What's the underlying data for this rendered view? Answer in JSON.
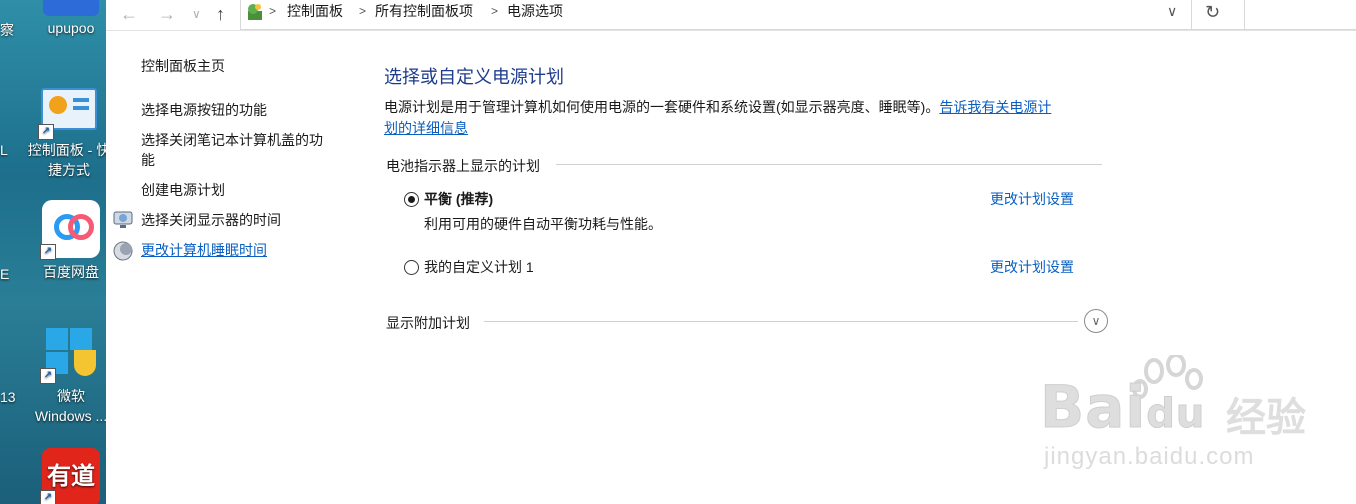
{
  "desktop": {
    "icons": [
      {
        "label": "upupoo"
      },
      {
        "label": "控制面板 - 快捷方式",
        "label_line1": "控制面板 - 快",
        "label_line2": "捷方式"
      },
      {
        "label": "百度网盘"
      },
      {
        "label": "微软 Windows ...",
        "label_line1": "微软",
        "label_line2": "Windows ..."
      },
      {
        "label": "有道"
      }
    ],
    "edge_fragments": [
      "察",
      "L",
      "E",
      "13"
    ]
  },
  "addressbar": {
    "back_icon": "arrow-left-icon",
    "forward_icon": "arrow-right-icon",
    "recent_icon": "chevron-down-icon",
    "up_icon": "arrow-up-icon",
    "breadcrumbs": [
      "控制面板",
      "所有控制面板项",
      "电源选项"
    ],
    "dropdown_icon": "chevron-down-icon",
    "refresh_icon": "refresh-icon",
    "search_placeholder": ""
  },
  "sidebar": {
    "home": "控制面板主页",
    "links": [
      {
        "label": "选择电源按钮的功能"
      },
      {
        "label": "选择关闭笔记本计算机盖的功能",
        "line1": "选择关闭笔记本计算机盖的功",
        "line2": "能"
      },
      {
        "label": "创建电源计划"
      },
      {
        "label": "选择关闭显示器的时间",
        "icon": "monitor-icon"
      },
      {
        "label": "更改计算机睡眠时间",
        "icon": "moon-icon"
      }
    ]
  },
  "main": {
    "title": "选择或自定义电源计划",
    "description": "电源计划是用于管理计算机如何使用电源的一套硬件和系统设置(如显示器亮度、睡眠等)。",
    "description_link_line1": "告诉我有关电源计",
    "description_link_line2": "划的详细信息",
    "battery_section": "电池指示器上显示的计划",
    "plans": [
      {
        "name": "平衡 (推荐)",
        "description": "利用可用的硬件自动平衡功耗与性能。",
        "selected": true,
        "change_link": "更改计划设置"
      },
      {
        "name": "我的自定义计划 1",
        "description": "",
        "selected": false,
        "change_link": "更改计划设置"
      }
    ],
    "additional_section": "显示附加计划",
    "expand_icon": "chevron-down-circle-icon"
  },
  "watermark": {
    "brand": "Bai",
    "brand2": "du",
    "cn": "经验",
    "sub": "jingyan.baidu.com"
  },
  "colors": {
    "title": "#1e3c8c",
    "link": "#0b5fc2",
    "desktop": "#2a7e96"
  }
}
